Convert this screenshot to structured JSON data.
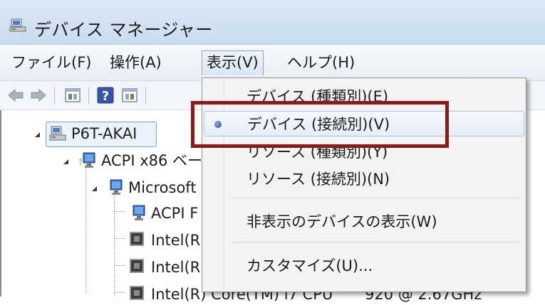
{
  "window": {
    "title": "デバイス マネージャー"
  },
  "menubar": {
    "items": [
      {
        "id": "file",
        "label": "ファイル(F)"
      },
      {
        "id": "action",
        "label": "操作(A)"
      },
      {
        "id": "view",
        "label": "表示(V)"
      },
      {
        "id": "help",
        "label": "ヘルプ(H)"
      }
    ]
  },
  "toolbar": {
    "icons": [
      "back-icon",
      "forward-icon",
      "properties-icon",
      "help-icon",
      "update-driver-icon"
    ]
  },
  "tree": {
    "root": "P6T-AKAI",
    "acpi": "ACPI x86 ベー",
    "microsoft": "Microsoft ,",
    "acpi_f": "ACPI F",
    "intel1": "Intel(R",
    "intel2": "Intel(R",
    "intel3_a": "Intel(R) Core(TM) i7 CPU",
    "intel3_b": "920  @ 2.67GHz"
  },
  "dropdown": {
    "items": [
      {
        "label": "デバイス (種類別)(E)",
        "checked": false
      },
      {
        "label": "デバイス (接続別)(V)",
        "checked": true
      },
      {
        "label": "リソース (種類別)(Y)",
        "checked": false
      },
      {
        "label": "リソース (接続別)(N)",
        "checked": false
      },
      {
        "label": "非表示のデバイスの表示(W)",
        "checked": false
      },
      {
        "label": "カスタマイズ(U)...",
        "checked": false
      }
    ]
  },
  "colors": {
    "highlight_border": "#8b1a1a",
    "menu_hover": "#a9c6e8"
  }
}
